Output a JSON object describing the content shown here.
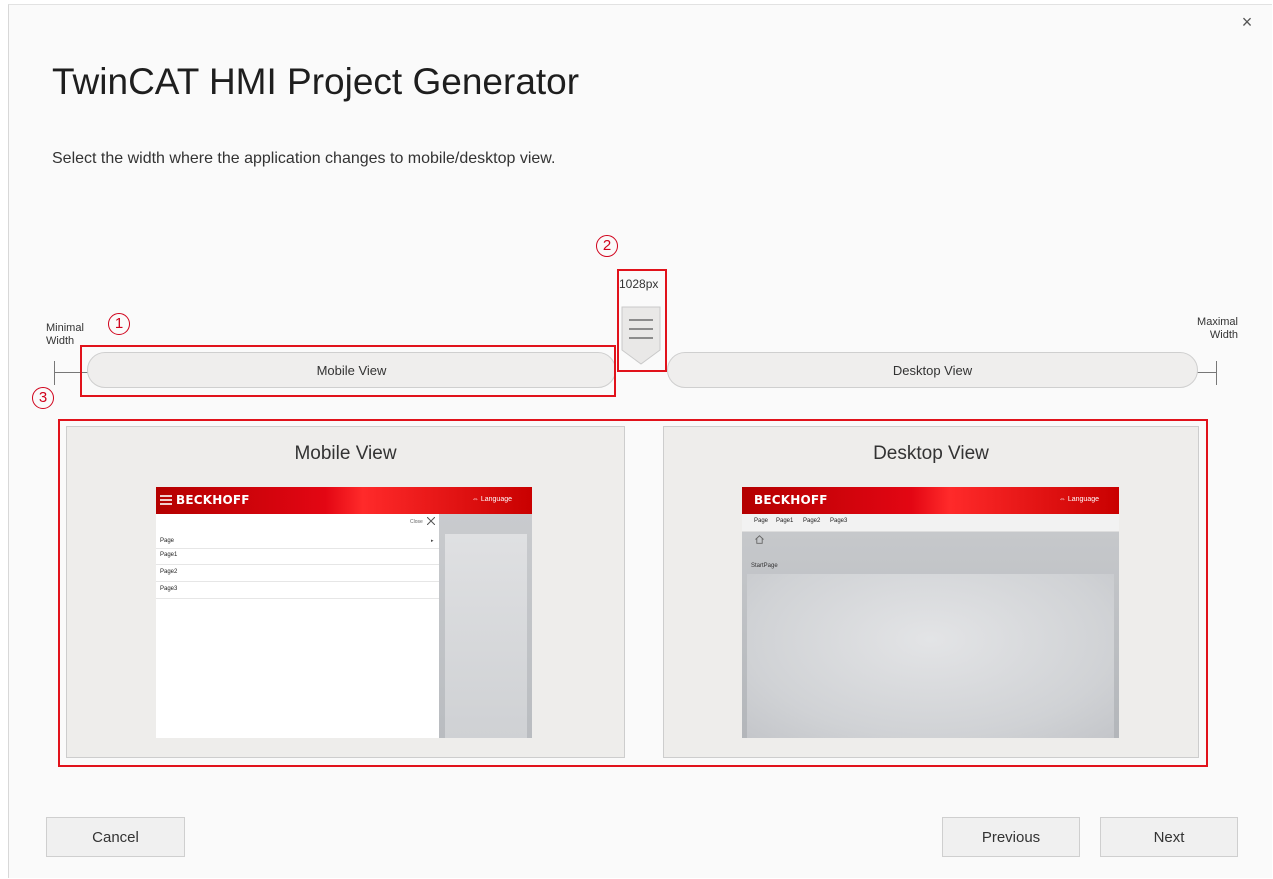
{
  "window": {
    "title": "TwinCAT HMI Project Generator",
    "subtitle": "Select the width where the application changes to mobile/desktop view.",
    "close_glyph": "×"
  },
  "annotations": {
    "badge_1": "1",
    "badge_2": "2",
    "badge_3": "3",
    "color": "#e1121b"
  },
  "slider": {
    "min_label_line1": "Minimal",
    "min_label_line2": "Width",
    "max_label_line1": "Maximal",
    "max_label_line2": "Width",
    "breakpoint": "1028px",
    "handle_icon": "hamburger-icon",
    "mobile_segment_label": "Mobile View",
    "desktop_segment_label": "Desktop View"
  },
  "previews": {
    "mobile": {
      "title": "Mobile View",
      "logo": "BECKHOFF",
      "language": "⇔ Language",
      "close_label": "Close",
      "menu_items": [
        "Page",
        "Page1",
        "Page2",
        "Page3"
      ]
    },
    "desktop": {
      "title": "Desktop View",
      "logo": "BECKHOFF",
      "language": "⇔ Language",
      "nav_items": [
        "Page",
        "Page1",
        "Page2",
        "Page3"
      ],
      "start_page": "StartPage"
    }
  },
  "buttons": {
    "cancel": "Cancel",
    "previous": "Previous",
    "next": "Next"
  },
  "colors": {
    "brand_red": "#e30613",
    "panel_bg": "#eeedeb",
    "window_bg": "#fafafa"
  }
}
